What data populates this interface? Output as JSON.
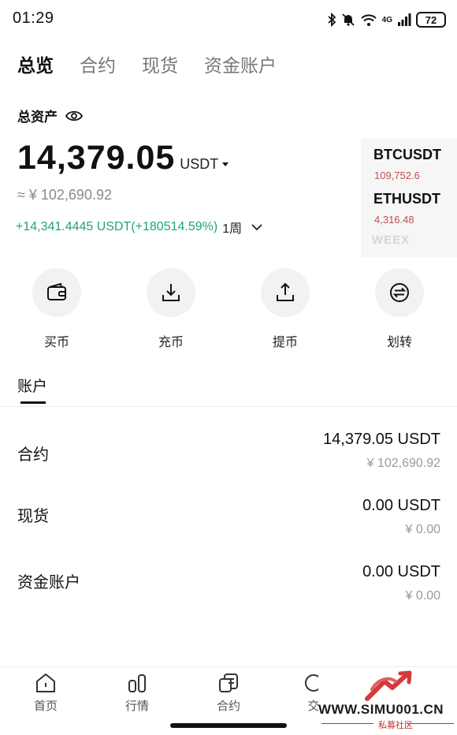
{
  "status_bar": {
    "time": "01:29",
    "network": "4G",
    "battery": "72"
  },
  "top_tabs": [
    {
      "label": "总览",
      "active": true
    },
    {
      "label": "合约",
      "active": false
    },
    {
      "label": "现货",
      "active": false
    },
    {
      "label": "资金账户",
      "active": false
    }
  ],
  "overview": {
    "total_label": "总资产",
    "total_amount": "14,379.05",
    "unit": "USDT",
    "cny_equiv": "≈ ¥ 102,690.92",
    "pnl": "+14,341.4445 USDT(+180514.59%)",
    "period": "1周"
  },
  "ticker": [
    {
      "symbol": "BTCUSDT",
      "price": "109,752.6"
    },
    {
      "symbol": "ETHUSDT",
      "price": "4,316.48"
    }
  ],
  "ticker_logo": "WEEX",
  "actions": [
    {
      "label": "买币",
      "icon": "wallet-icon"
    },
    {
      "label": "充币",
      "icon": "deposit-icon"
    },
    {
      "label": "提币",
      "icon": "withdraw-icon"
    },
    {
      "label": "划转",
      "icon": "transfer-icon"
    }
  ],
  "accounts_section": {
    "tab_label": "账户"
  },
  "accounts": [
    {
      "name": "合约",
      "value": "14,379.05 USDT",
      "cny": "¥ 102,690.92"
    },
    {
      "name": "现货",
      "value": "0.00 USDT",
      "cny": "¥ 0.00"
    },
    {
      "name": "资金账户",
      "value": "0.00 USDT",
      "cny": "¥ 0.00"
    }
  ],
  "bottom_nav": [
    {
      "label": "首页",
      "icon": "home-icon"
    },
    {
      "label": "行情",
      "icon": "market-icon"
    },
    {
      "label": "合约",
      "icon": "contract-icon"
    },
    {
      "label": "交",
      "icon": "trade-icon"
    }
  ],
  "watermark": {
    "url": "WWW.SIMU001.CN",
    "subtitle": "私募社区"
  },
  "colors": {
    "profit": "#1fa37a",
    "ticker_price": "#c0504d",
    "watermark": "#c03030"
  }
}
